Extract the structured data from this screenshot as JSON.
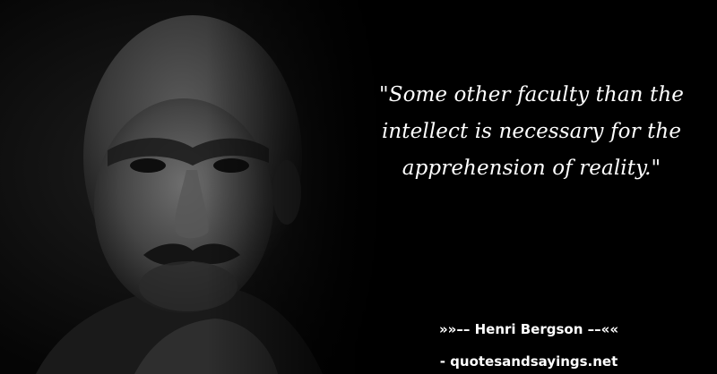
{
  "quote": {
    "text": "\"Some other faculty than the intellect is necessary for the apprehension of reality.\""
  },
  "attribution": {
    "author_line": "»»–– Henri Bergson ––««"
  },
  "footer": {
    "site_line": "- quotesandsayings.net"
  },
  "colors": {
    "background": "#000000",
    "text": "#ffffff"
  }
}
